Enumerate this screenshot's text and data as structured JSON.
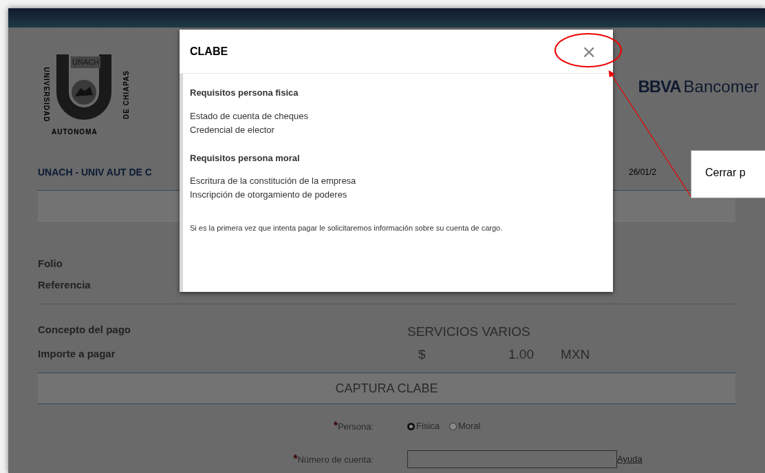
{
  "page": {
    "logo": {
      "left_text": "UNIVERSIDAD",
      "center_text": "UNACH",
      "right_text": "DE CHIAPAS",
      "bottom_text": "AUTONOMA"
    },
    "bank_logo": {
      "bold": "BBVA",
      "rest": "Bancomer"
    },
    "merchant": "UNACH - UNIV AUT DE C",
    "date": "26/01/2",
    "fields": [
      {
        "label": "Folio"
      },
      {
        "label": "Referencia"
      }
    ],
    "concept": {
      "label": "Concepto del pago",
      "value": "SERVICIOS VARIOS"
    },
    "amount": {
      "label": "Importe a pagar",
      "currency_sign": "$",
      "value": "1.00",
      "currency": "MXN"
    },
    "section_title": "CAPTURA CLABE",
    "persona": {
      "required_mark": "*",
      "label": "Persona:",
      "options": [
        {
          "label": "Fisica",
          "selected": true
        },
        {
          "label": "Moral",
          "selected": false
        }
      ]
    },
    "account": {
      "required_mark": "*",
      "label": "Número de cuenta:",
      "help_link": "Ayuda"
    }
  },
  "modal": {
    "title": "CLABE",
    "close_glyph": "×",
    "sections": [
      {
        "heading": "Requisitos persona fisica",
        "items": [
          "Estado de cuenta de cheques",
          "Credencial de elector"
        ]
      },
      {
        "heading": "Requisitos persona moral",
        "items": [
          "Escritura de la constitución de la empresa",
          "Inscripción de otorgamiento de poderes"
        ]
      }
    ],
    "note": "Si es la primera vez que intenta pagar le solicitaremos información sobre su cuenta de cargo."
  },
  "annotation": {
    "callout": "Cerrar p"
  }
}
